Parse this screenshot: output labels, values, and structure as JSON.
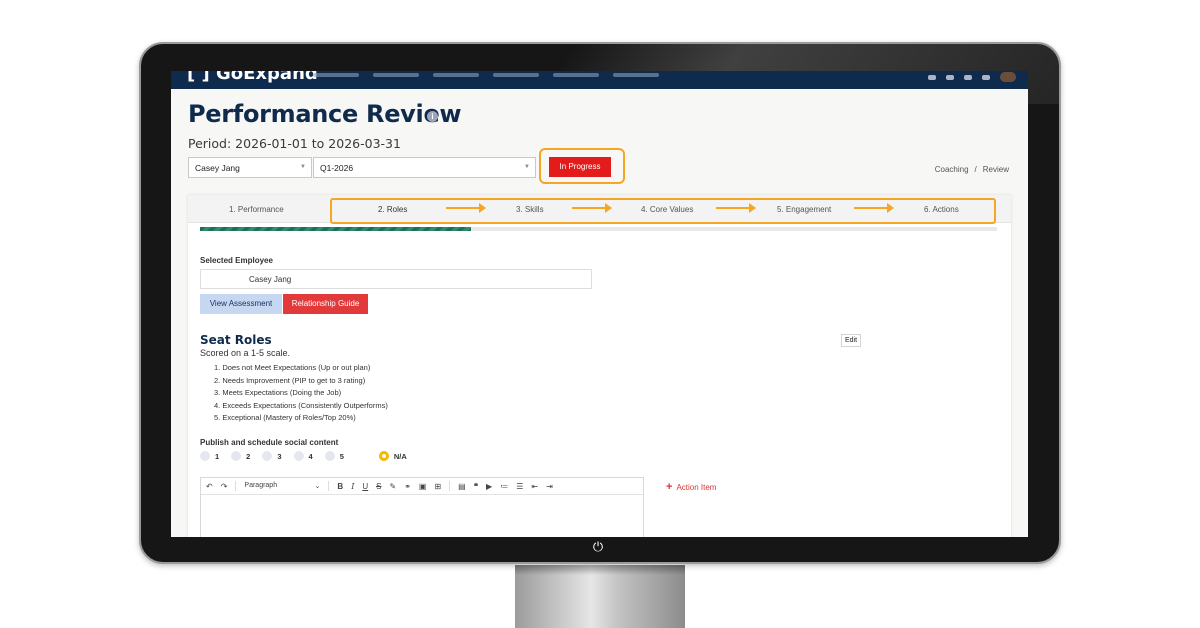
{
  "app": {
    "logo": "[ ] GoExpand"
  },
  "page": {
    "title": "Performance Review",
    "period": "Period: 2026-01-01 to 2026-03-31"
  },
  "filters": {
    "employee": "Casey Jang",
    "quarter": "Q1-2026"
  },
  "status": {
    "label": "In Progress"
  },
  "breadcrumb": {
    "parent": "Coaching",
    "separator": "/",
    "current": "Review"
  },
  "steps": [
    {
      "label": "1. Performance"
    },
    {
      "label": "2. Roles"
    },
    {
      "label": "3. Skills"
    },
    {
      "label": "4. Core Values"
    },
    {
      "label": "5. Engagement"
    },
    {
      "label": "6. Actions"
    }
  ],
  "progress": {
    "fraction": 0.34
  },
  "employee_section": {
    "label": "Selected Employee",
    "name": "Casey Jang",
    "view_button": "View Assessment",
    "guide_button": "Relationship Guide"
  },
  "seat_roles": {
    "title": "Seat Roles",
    "edit_label": "Edit",
    "scale_note": "Scored on a 1-5 scale.",
    "scale": [
      "1. Does not Meet Expectations (Up or out plan)",
      "2. Needs Improvement (PIP to get to 3 rating)",
      "3. Meets Expectations (Doing the Job)",
      "4. Exceeds Expectations (Consistently Outperforms)",
      "5. Exceptional (Mastery of Roles/Top 20%)"
    ]
  },
  "question": {
    "label": "Publish and schedule social content",
    "options": [
      "1",
      "2",
      "3",
      "4",
      "5",
      "N/A"
    ],
    "selected": "N/A"
  },
  "editor": {
    "paragraph_label": "Paragraph",
    "action_item": "Action Item"
  },
  "colors": {
    "navy": "#102a4c",
    "status_red": "#e31b1b",
    "highlight_orange": "#f5a623",
    "progress_green": "#1f6e5a"
  }
}
